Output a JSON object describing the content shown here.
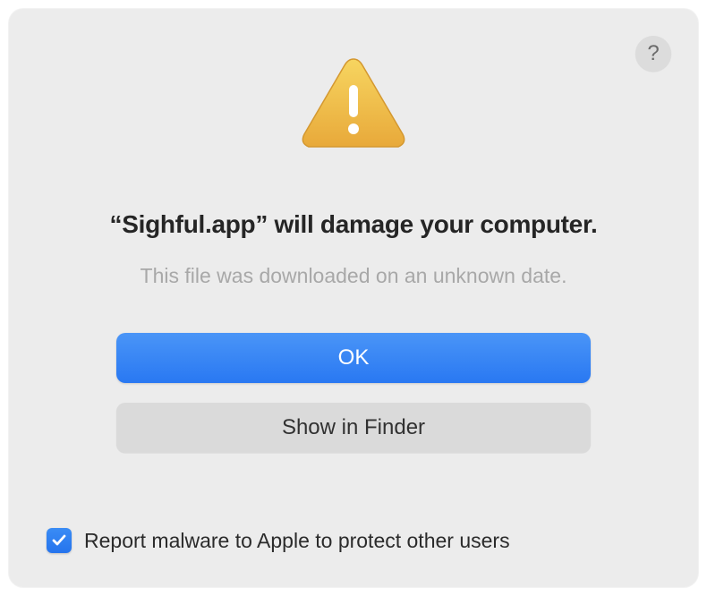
{
  "help_button": "?",
  "dialog": {
    "title": "“Sighful.app” will damage your computer.",
    "subtitle": "This file was downloaded on an unknown date."
  },
  "buttons": {
    "primary": "OK",
    "secondary": "Show in Finder"
  },
  "checkbox": {
    "checked": true,
    "label": "Report malware to Apple to protect other users"
  }
}
